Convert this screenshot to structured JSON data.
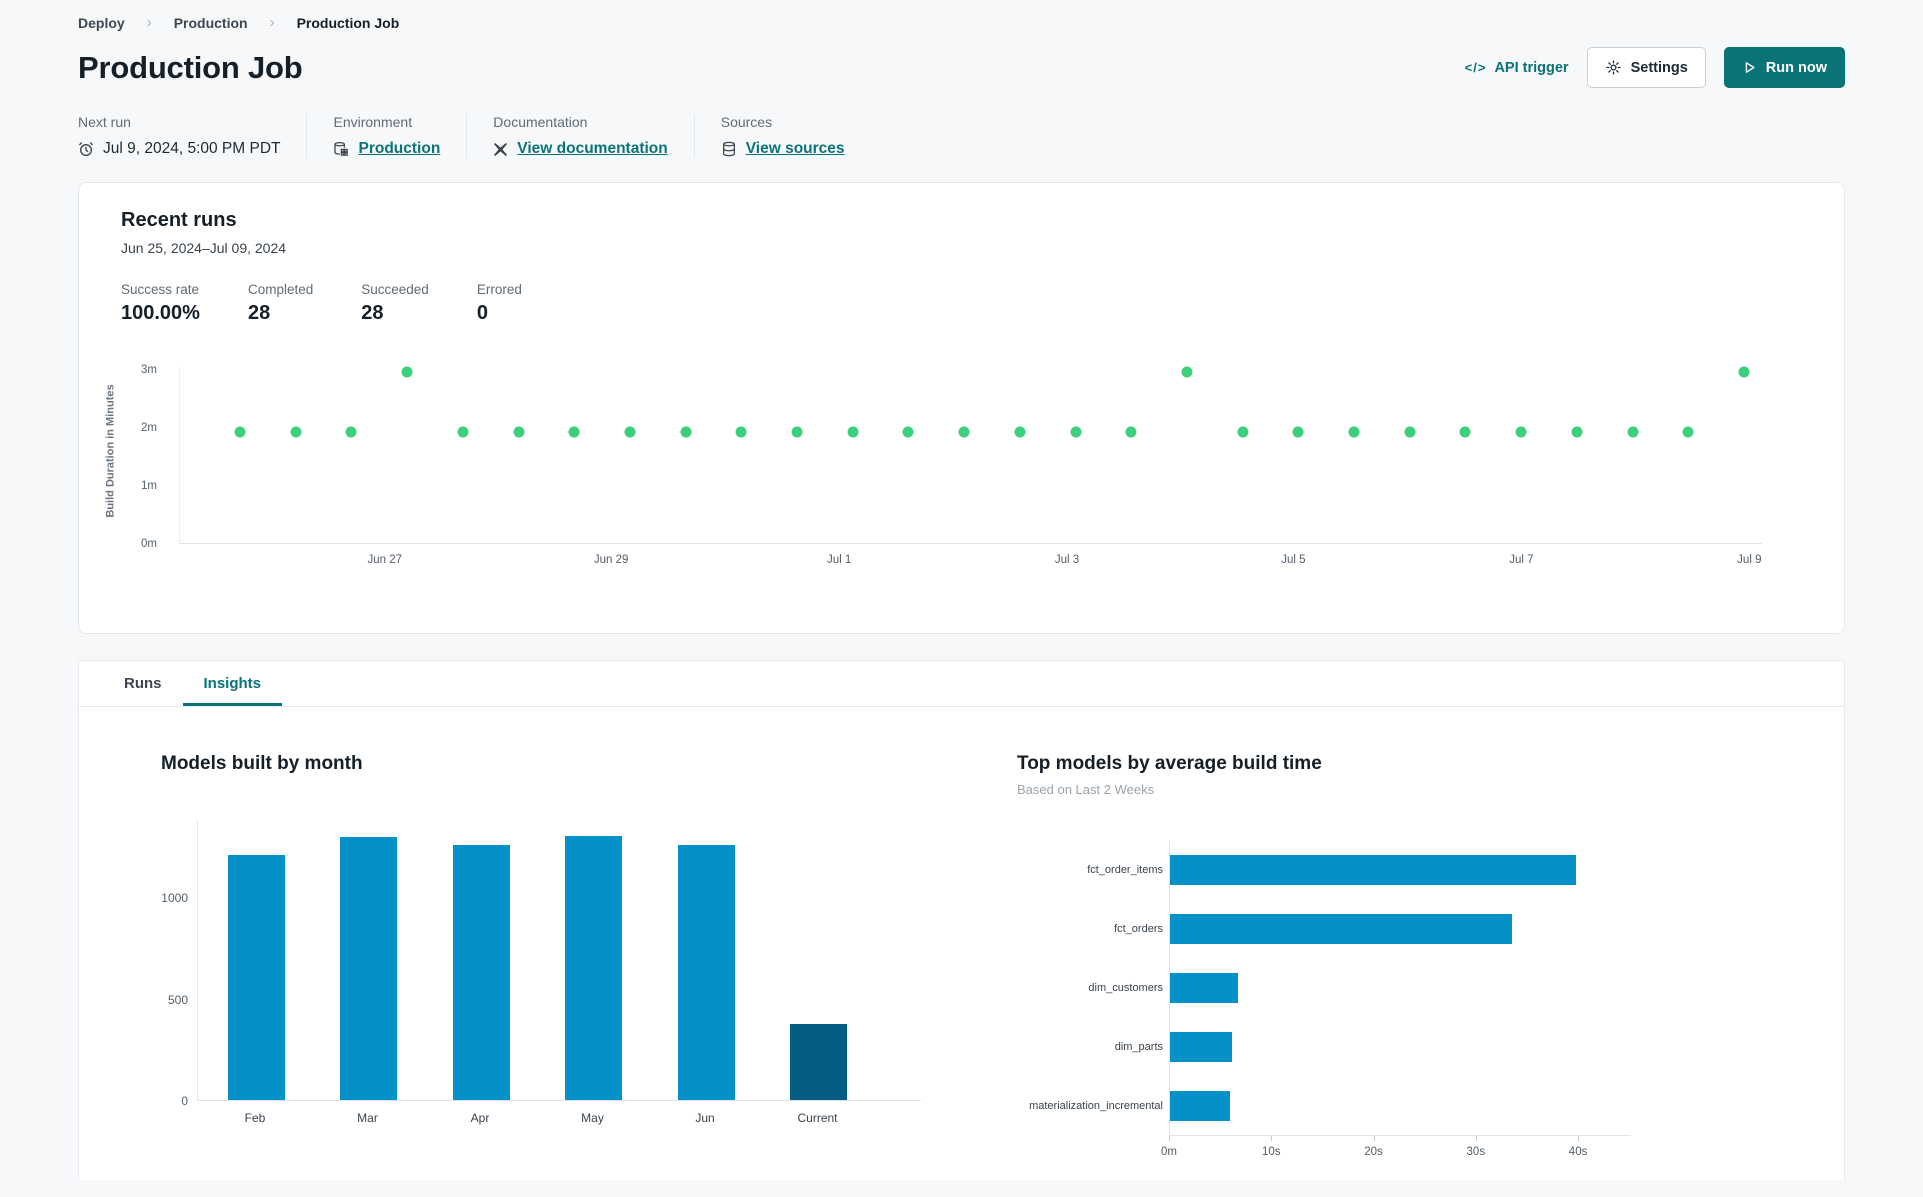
{
  "breadcrumb": [
    "Deploy",
    "Production",
    "Production Job"
  ],
  "header": {
    "title": "Production Job",
    "api_trigger_label": "API trigger",
    "settings_label": "Settings",
    "run_now_label": "Run now"
  },
  "meta": [
    {
      "label": "Next run",
      "value": "Jul 9, 2024, 5:00 PM PDT",
      "icon": "alarm-clock-icon",
      "link": false
    },
    {
      "label": "Environment",
      "value": "Production",
      "icon": "environment-icon",
      "link": true
    },
    {
      "label": "Documentation",
      "value": "View documentation",
      "icon": "docs-icon",
      "link": true
    },
    {
      "label": "Sources",
      "value": "View sources",
      "icon": "database-icon",
      "link": true
    }
  ],
  "recent_runs": {
    "title": "Recent runs",
    "date_range": "Jun 25, 2024–Jul 09, 2024",
    "stats": [
      {
        "label": "Success rate",
        "value": "100.00%"
      },
      {
        "label": "Completed",
        "value": "28"
      },
      {
        "label": "Succeeded",
        "value": "28"
      },
      {
        "label": "Errored",
        "value": "0"
      }
    ]
  },
  "tabs": [
    {
      "label": "Runs",
      "active": false
    },
    {
      "label": "Insights",
      "active": true
    }
  ],
  "colors": {
    "accent_teal": "#0a7377",
    "success_green": "#3dd07a",
    "bar_blue": "#0490c8",
    "bar_dark_blue": "#055d83"
  },
  "chart_data": [
    {
      "id": "build_duration",
      "type": "scatter",
      "title": "Recent runs",
      "ylabel": "Build Duration in Minutes",
      "ylim": [
        0,
        3.05
      ],
      "yticks": [
        {
          "label": "0m",
          "value": 0
        },
        {
          "label": "1m",
          "value": 1
        },
        {
          "label": "2m",
          "value": 2
        },
        {
          "label": "3m",
          "value": 3
        }
      ],
      "xticks": [
        {
          "label": "Jun 27",
          "f": 0.13
        },
        {
          "label": "Jun 29",
          "f": 0.273
        },
        {
          "label": "Jul 1",
          "f": 0.417
        },
        {
          "label": "Jul 3",
          "f": 0.561
        },
        {
          "label": "Jul 5",
          "f": 0.704
        },
        {
          "label": "Jul 7",
          "f": 0.848
        },
        {
          "label": "Jul 9",
          "f": 0.992
        }
      ],
      "point_color": "#3dd07a",
      "points_minutes": [
        1.93,
        1.93,
        1.93,
        2.97,
        1.93,
        1.93,
        1.93,
        1.93,
        1.93,
        1.93,
        1.93,
        1.93,
        1.93,
        1.93,
        1.93,
        1.93,
        1.93,
        2.97,
        1.93,
        1.93,
        1.93,
        1.93,
        1.93,
        1.93,
        1.93,
        1.93,
        1.93,
        2.97
      ],
      "legend": "none",
      "grid": false
    },
    {
      "id": "models_by_month",
      "type": "bar",
      "title": "Models built by month",
      "categories": [
        "Feb",
        "Mar",
        "Apr",
        "May",
        "Jun",
        "Current"
      ],
      "values": [
        1210,
        1295,
        1255,
        1300,
        1255,
        375
      ],
      "yticks": [
        0,
        500,
        1000
      ],
      "ylim": [
        0,
        1380
      ],
      "bar_color": "#0490c8",
      "highlight_category": "Current",
      "highlight_color": "#055d83",
      "grid": false
    },
    {
      "id": "top_models",
      "type": "bar",
      "orientation": "horizontal",
      "title": "Top models by average build time",
      "subtitle": "Based on Last 2 Weeks",
      "categories": [
        "fct_order_items",
        "fct_orders",
        "dim_customers",
        "dim_parts",
        "materialization_incremental"
      ],
      "values_seconds": [
        39.7,
        33.4,
        6.6,
        6.1,
        5.9
      ],
      "xticks": [
        {
          "label": "0m",
          "value": 0
        },
        {
          "label": "10s",
          "value": 10
        },
        {
          "label": "20s",
          "value": 20
        },
        {
          "label": "30s",
          "value": 30
        },
        {
          "label": "40s",
          "value": 40
        }
      ],
      "xlim": [
        0,
        44
      ],
      "bar_color": "#0490c8",
      "grid": false
    }
  ]
}
